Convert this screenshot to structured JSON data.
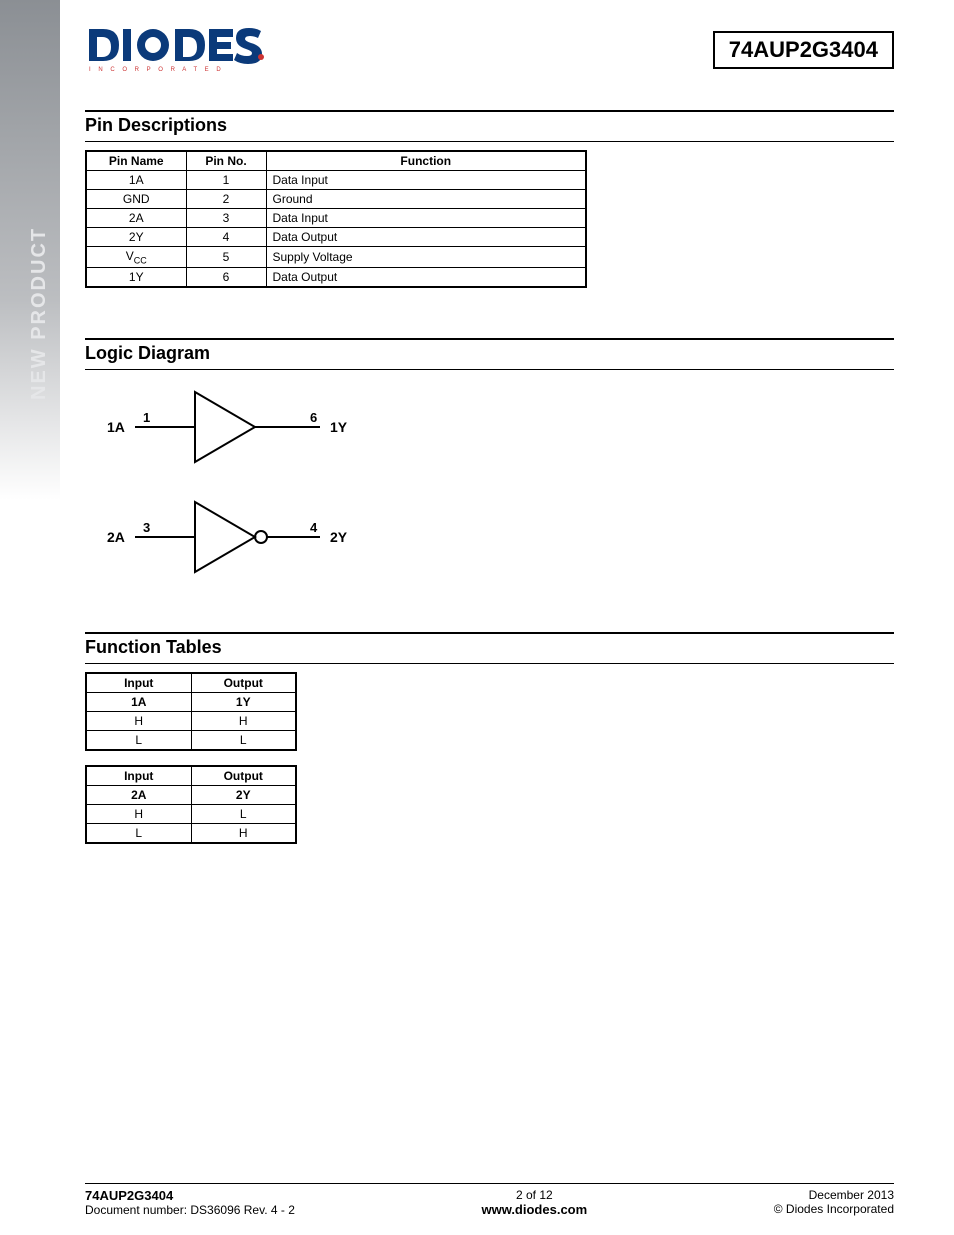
{
  "sidebar": {
    "label": "NEW PRODUCT"
  },
  "header": {
    "part_number": "74AUP2G3404",
    "logo_text": "DIODES",
    "logo_sub": "I N C O R P O R A T E D"
  },
  "sections": {
    "pin_desc": {
      "title": "Pin Descriptions",
      "headers": [
        "Pin Name",
        "Pin No.",
        "Function"
      ],
      "rows": [
        {
          "name": "1A",
          "no": "1",
          "func": "Data Input"
        },
        {
          "name": "GND",
          "no": "2",
          "func": "Ground"
        },
        {
          "name": "2A",
          "no": "3",
          "func": "Data Input"
        },
        {
          "name": "2Y",
          "no": "4",
          "func": "Data Output"
        },
        {
          "name": "V",
          "name_sub": "CC",
          "no": "5",
          "func": "Supply Voltage"
        },
        {
          "name": "1Y",
          "no": "6",
          "func": "Data Output"
        }
      ]
    },
    "logic_diagram": {
      "title": "Logic Diagram",
      "gates": [
        {
          "in_label": "1A",
          "in_pin": "1",
          "out_pin": "6",
          "out_label": "1Y",
          "inverted": false
        },
        {
          "in_label": "2A",
          "in_pin": "3",
          "out_pin": "4",
          "out_label": "2Y",
          "inverted": true
        }
      ]
    },
    "function_tables": {
      "title": "Function Tables",
      "tables": [
        {
          "headers_top": [
            "Input",
            "Output"
          ],
          "headers_sub": [
            "1A",
            "1Y"
          ],
          "rows": [
            [
              "H",
              "H"
            ],
            [
              "L",
              "L"
            ]
          ]
        },
        {
          "headers_top": [
            "Input",
            "Output"
          ],
          "headers_sub": [
            "2A",
            "2Y"
          ],
          "rows": [
            [
              "H",
              "L"
            ],
            [
              "L",
              "H"
            ]
          ]
        }
      ]
    }
  },
  "footer": {
    "left_part": "74AUP2G3404",
    "left_doc": "Document number: DS36096   Rev. 4 - 2",
    "center_page": "2 of 12",
    "center_url": "www.diodes.com",
    "right_date": "December 2013",
    "right_copy": "© Diodes Incorporated"
  }
}
